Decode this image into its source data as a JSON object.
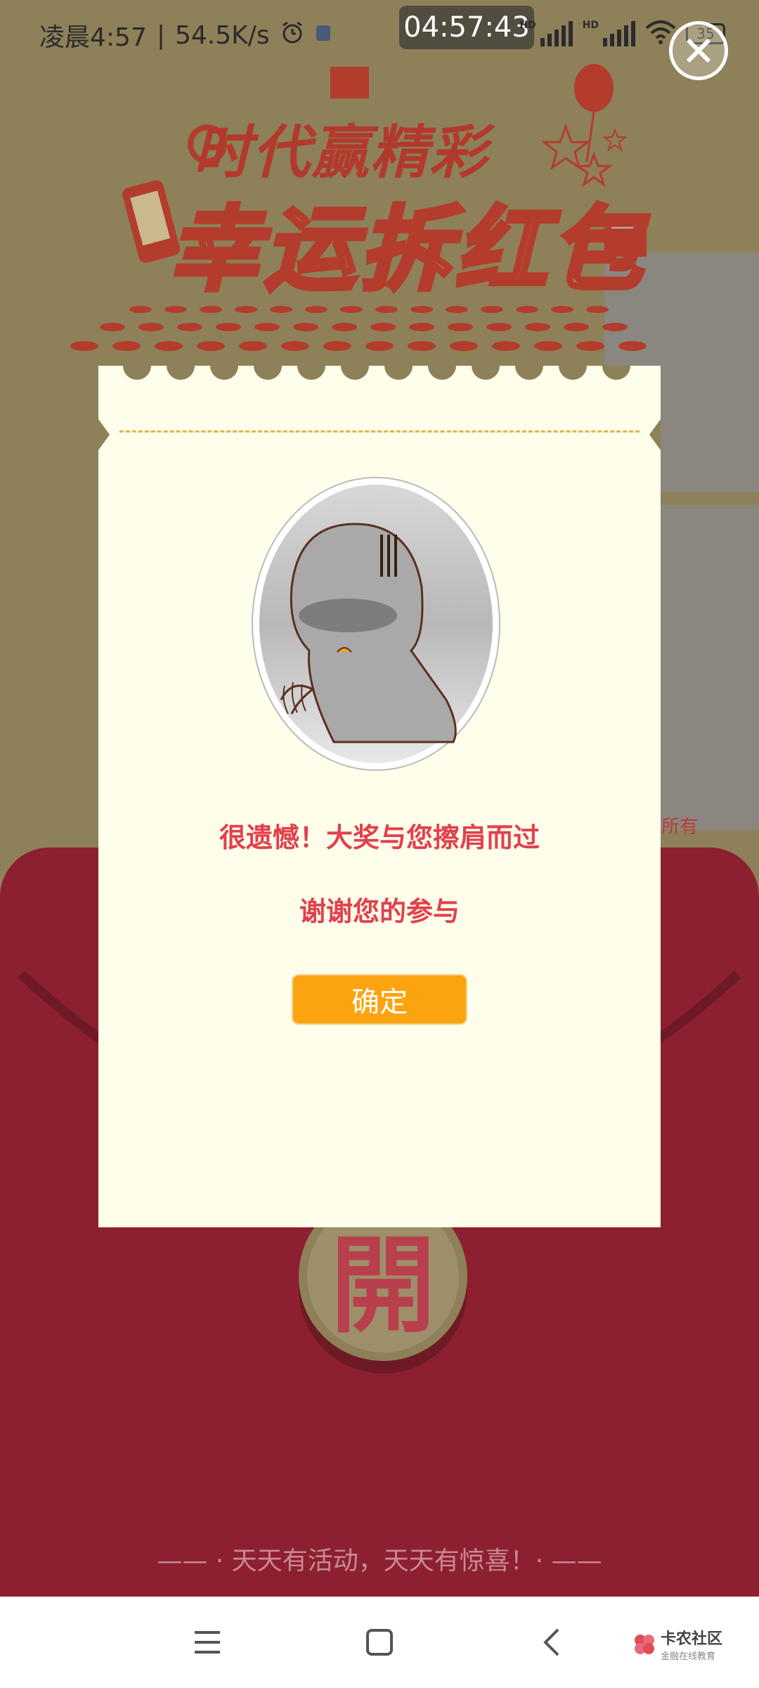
{
  "status_bar": {
    "time_label": "凌晨4:57",
    "speed": "54.5K/s",
    "clock_pill": "04:57:43",
    "hd1": "HD",
    "hd2": "HD",
    "battery": "35"
  },
  "banner": {
    "line1": "时代赢精彩",
    "line2": "幸运拆红包",
    "logo_letter": "e"
  },
  "background": {
    "partial_text": "行所有"
  },
  "envelope": {
    "open_char": "開",
    "slogan": "—— · 天天有活动，天天有惊喜！· ——"
  },
  "modal": {
    "message_line1": "很遗憾！大奖与您擦肩而过",
    "message_line2": "谢谢您的参与",
    "confirm_label": "确定"
  },
  "nav": {
    "icons": [
      "menu-icon",
      "home-icon",
      "back-icon"
    ]
  },
  "watermark": {
    "name": "卡农社区",
    "tagline": "金融在线教育"
  },
  "colors": {
    "background": "#8e8059",
    "envelope_red": "#8d2030",
    "modal_bg": "#fefeeb",
    "message_red": "#e2404d",
    "button_orange": "#fba40f",
    "dash_yellow": "#e4b24a"
  }
}
